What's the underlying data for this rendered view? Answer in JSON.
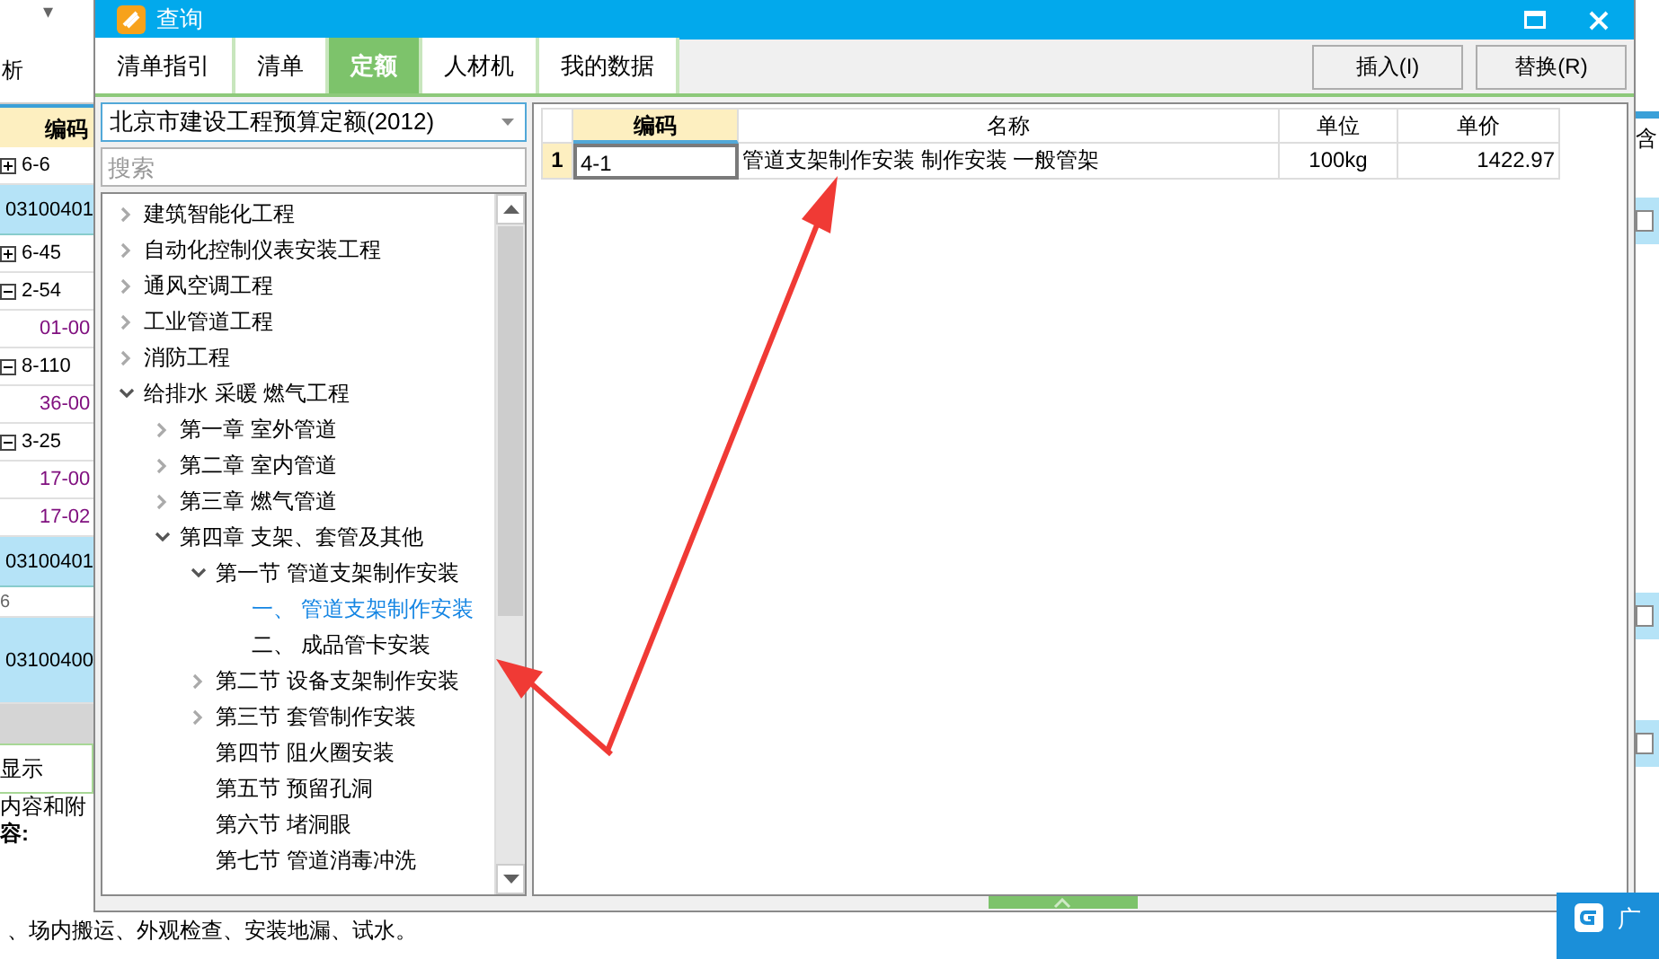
{
  "background_app": {
    "dropdown_caret": "▾",
    "toolbar_label": "析",
    "column_header": "编码",
    "rows": [
      {
        "kind": "plus",
        "text": "6-6"
      },
      {
        "kind": "item",
        "text": "03100401"
      },
      {
        "kind": "plus",
        "text": "6-45"
      },
      {
        "kind": "minus",
        "text": "2-54"
      },
      {
        "kind": "child",
        "text": "01-00"
      },
      {
        "kind": "minus",
        "text": "8-110"
      },
      {
        "kind": "child",
        "text": "36-00"
      },
      {
        "kind": "minus",
        "text": "3-25"
      },
      {
        "kind": "child",
        "text": "17-00"
      },
      {
        "kind": "child",
        "text": "17-02"
      },
      {
        "kind": "item",
        "text": "03100401"
      },
      {
        "kind": "small",
        "text": "6"
      },
      {
        "kind": "tall",
        "text": "03100400"
      }
    ],
    "tab_label": "显示",
    "section_label": "内容和附",
    "content_label": "容:",
    "content_text": "、场内搬运、外观检查、安装地漏、试水。",
    "right_header": "含",
    "right_checkboxes": [
      {
        "checked": false
      },
      {
        "checked": false
      },
      {
        "checked": false
      }
    ],
    "notification_text": "广"
  },
  "dialog": {
    "title": "查询",
    "tabs": [
      {
        "label": "清单指引",
        "selected": false
      },
      {
        "label": "清单",
        "selected": false
      },
      {
        "label": "定额",
        "selected": true
      },
      {
        "label": "人材机",
        "selected": false
      },
      {
        "label": "我的数据",
        "selected": false
      }
    ],
    "buttons": [
      "插入(I)",
      "替换(R)"
    ],
    "library": {
      "value": "北京市建设工程预算定额(2012)"
    },
    "search": {
      "placeholder": "搜索"
    },
    "tree": [
      {
        "label": "建筑智能化工程",
        "kind": "folder",
        "expanded": false,
        "selected": false
      },
      {
        "label": "自动化控制仪表安装工程",
        "kind": "folder",
        "expanded": false,
        "selected": false
      },
      {
        "label": "通风空调工程",
        "kind": "folder",
        "expanded": false,
        "selected": false
      },
      {
        "label": "工业管道工程",
        "kind": "folder",
        "expanded": false,
        "selected": false
      },
      {
        "label": "消防工程",
        "kind": "folder",
        "expanded": false,
        "selected": false
      },
      {
        "label": "给排水 采暖 燃气工程",
        "kind": "folder",
        "expanded": true,
        "selected": false,
        "children": [
          {
            "label": "第一章 室外管道",
            "kind": "folder",
            "expanded": false,
            "selected": false
          },
          {
            "label": "第二章 室内管道",
            "kind": "folder",
            "expanded": false,
            "selected": false
          },
          {
            "label": "第三章 燃气管道",
            "kind": "folder",
            "expanded": false,
            "selected": false
          },
          {
            "label": "第四章 支架、套管及其他",
            "kind": "folder",
            "expanded": true,
            "selected": false,
            "children": [
              {
                "label": "第一节 管道支架制作安装",
                "kind": "folder",
                "expanded": true,
                "selected": false,
                "children": [
                  {
                    "label": "一、 管道支架制作安装",
                    "kind": "leaf",
                    "selected": true
                  },
                  {
                    "label": "二、 成品管卡安装",
                    "kind": "leaf",
                    "selected": false
                  }
                ]
              },
              {
                "label": "第二节 设备支架制作安装",
                "kind": "folder",
                "expanded": false,
                "selected": false
              },
              {
                "label": "第三节 套管制作安装",
                "kind": "folder",
                "expanded": false,
                "selected": false
              },
              {
                "label": "第四节 阻火圈安装",
                "kind": "leaf",
                "selected": false
              },
              {
                "label": "第五节 预留孔洞",
                "kind": "leaf",
                "selected": false
              },
              {
                "label": "第六节 堵洞眼",
                "kind": "leaf",
                "selected": false
              },
              {
                "label": "第七节 管道消毒冲洗",
                "kind": "leaf",
                "selected": false
              }
            ]
          }
        ]
      }
    ],
    "table": {
      "columns": [
        {
          "label": "编码",
          "highlighted": true
        },
        {
          "label": "名称",
          "highlighted": false
        },
        {
          "label": "单位",
          "highlighted": false
        },
        {
          "label": "单价",
          "highlighted": false
        }
      ],
      "rows": [
        {
          "number": "1",
          "cells": [
            {
              "text": "4-1",
              "selected": true
            },
            {
              "text": "管道支架制作安装 制作安装 一般管架",
              "selected": false
            },
            {
              "text": "100kg",
              "selected": false
            },
            {
              "text": "1422.97",
              "selected": false
            }
          ]
        }
      ]
    }
  }
}
